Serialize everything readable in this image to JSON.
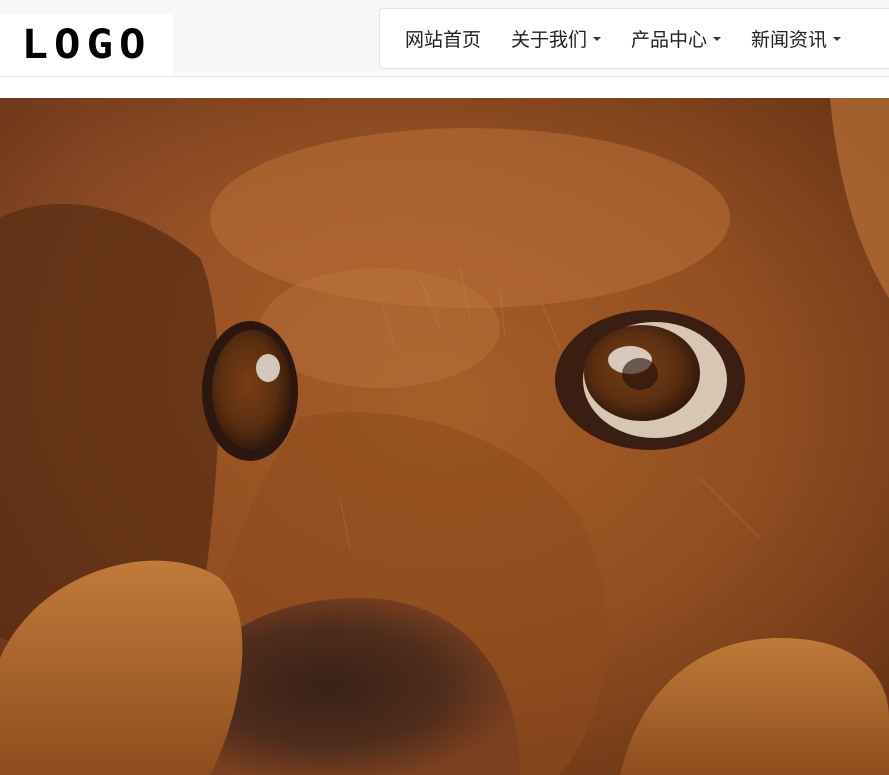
{
  "logo": {
    "text": "LOGO"
  },
  "nav": {
    "items": [
      {
        "label": "网站首页",
        "dropdown": false
      },
      {
        "label": "关于我们",
        "dropdown": true
      },
      {
        "label": "产品中心",
        "dropdown": true
      },
      {
        "label": "新闻资讯",
        "dropdown": true
      }
    ]
  },
  "hero": {
    "subject": "close-up photo of a brown dog resting its head on its paws",
    "colors": {
      "fur": "#a55a24",
      "dark": "#4a2512",
      "eye": "#5b2f12"
    }
  }
}
